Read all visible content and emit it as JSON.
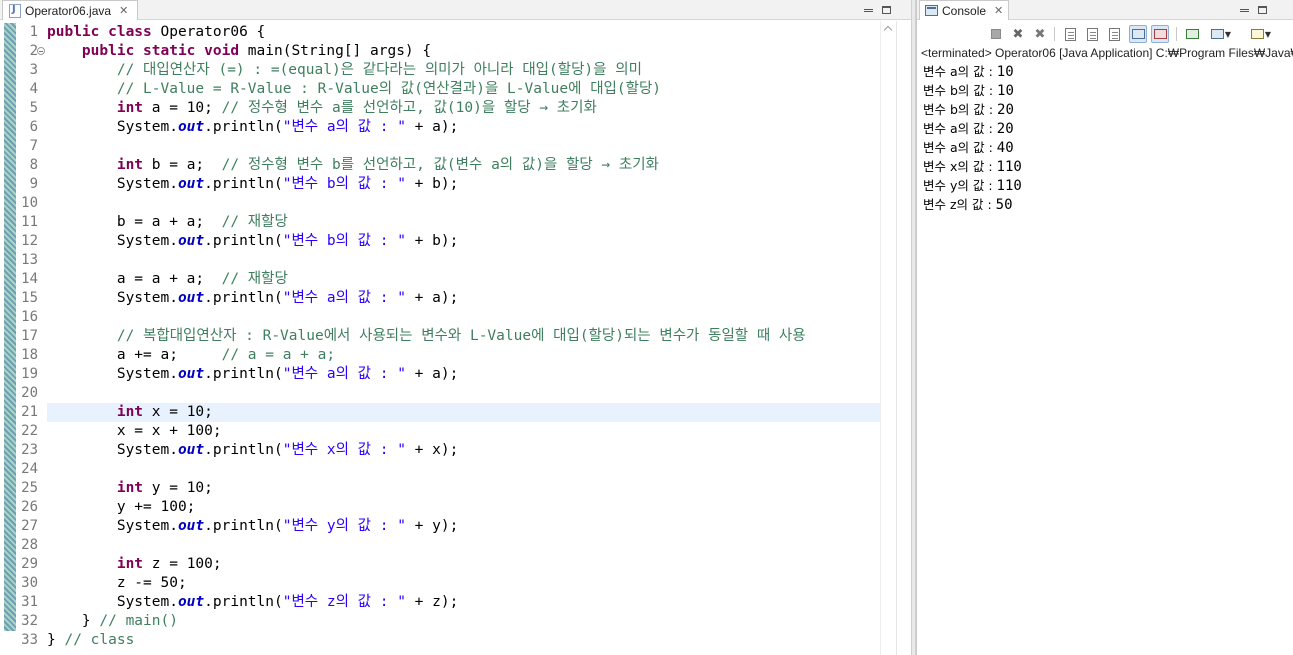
{
  "editor": {
    "tab_title": "Operator06.java",
    "tab_close": "✕",
    "current_line": 21,
    "lines": [
      {
        "n": "1",
        "fold": false,
        "segs": [
          [
            "kw",
            "public class "
          ],
          [
            "",
            "Operator06 {"
          ]
        ]
      },
      {
        "n": "2",
        "fold": true,
        "segs": [
          [
            "",
            "    "
          ],
          [
            "kw",
            "public static void "
          ],
          [
            "",
            "main(String[] args) {"
          ]
        ]
      },
      {
        "n": "3",
        "fold": false,
        "segs": [
          [
            "",
            "        "
          ],
          [
            "cm",
            "// 대입연산자 (=) : =(equal)은 같다라는 의미가 아니라 대입(할당)을 의미"
          ]
        ]
      },
      {
        "n": "4",
        "fold": false,
        "segs": [
          [
            "",
            "        "
          ],
          [
            "cm",
            "// L-Value = R-Value : R-Value의 값(연산결과)을 L-Value에 대입(할당)"
          ]
        ]
      },
      {
        "n": "5",
        "fold": false,
        "segs": [
          [
            "",
            "        "
          ],
          [
            "kw",
            "int"
          ],
          [
            "",
            " a = 10; "
          ],
          [
            "cm",
            "// 정수형 변수 a를 선언하고, 값(10)을 할당 → 초기화"
          ]
        ]
      },
      {
        "n": "6",
        "fold": false,
        "segs": [
          [
            "",
            "        System."
          ],
          [
            "fld",
            "out"
          ],
          [
            "",
            ".println("
          ],
          [
            "st",
            "\"변수 a의 값 : \""
          ],
          [
            "",
            " + a);"
          ]
        ]
      },
      {
        "n": "7",
        "fold": false,
        "segs": []
      },
      {
        "n": "8",
        "fold": false,
        "segs": [
          [
            "",
            "        "
          ],
          [
            "kw",
            "int"
          ],
          [
            "",
            " b = a;  "
          ],
          [
            "cm",
            "// 정수형 변수 b를 선언하고, 값(변수 a의 값)을 할당 → 초기화"
          ]
        ]
      },
      {
        "n": "9",
        "fold": false,
        "segs": [
          [
            "",
            "        System."
          ],
          [
            "fld",
            "out"
          ],
          [
            "",
            ".println("
          ],
          [
            "st",
            "\"변수 b의 값 : \""
          ],
          [
            "",
            " + b);"
          ]
        ]
      },
      {
        "n": "10",
        "fold": false,
        "segs": []
      },
      {
        "n": "11",
        "fold": false,
        "segs": [
          [
            "",
            "        b = a + a;  "
          ],
          [
            "cm",
            "// 재할당"
          ]
        ]
      },
      {
        "n": "12",
        "fold": false,
        "segs": [
          [
            "",
            "        System."
          ],
          [
            "fld",
            "out"
          ],
          [
            "",
            ".println("
          ],
          [
            "st",
            "\"변수 b의 값 : \""
          ],
          [
            "",
            " + b);"
          ]
        ]
      },
      {
        "n": "13",
        "fold": false,
        "segs": []
      },
      {
        "n": "14",
        "fold": false,
        "segs": [
          [
            "",
            "        a = a + a;  "
          ],
          [
            "cm",
            "// 재할당"
          ]
        ]
      },
      {
        "n": "15",
        "fold": false,
        "segs": [
          [
            "",
            "        System."
          ],
          [
            "fld",
            "out"
          ],
          [
            "",
            ".println("
          ],
          [
            "st",
            "\"변수 a의 값 : \""
          ],
          [
            "",
            " + a);"
          ]
        ]
      },
      {
        "n": "16",
        "fold": false,
        "segs": []
      },
      {
        "n": "17",
        "fold": false,
        "segs": [
          [
            "",
            "        "
          ],
          [
            "cm",
            "// 복합대입연산자 : R-Value에서 사용되는 변수와 L-Value에 대입(할당)되는 변수가 동일할 때 사용"
          ]
        ]
      },
      {
        "n": "18",
        "fold": false,
        "segs": [
          [
            "",
            "        a += a;     "
          ],
          [
            "cm",
            "// a = a + a;"
          ]
        ]
      },
      {
        "n": "19",
        "fold": false,
        "segs": [
          [
            "",
            "        System."
          ],
          [
            "fld",
            "out"
          ],
          [
            "",
            ".println("
          ],
          [
            "st",
            "\"변수 a의 값 : \""
          ],
          [
            "",
            " + a);"
          ]
        ]
      },
      {
        "n": "20",
        "fold": false,
        "segs": []
      },
      {
        "n": "21",
        "fold": false,
        "segs": [
          [
            "",
            "        "
          ],
          [
            "kw",
            "int"
          ],
          [
            "",
            " x = 10;"
          ]
        ]
      },
      {
        "n": "22",
        "fold": false,
        "segs": [
          [
            "",
            "        x = x + 100;"
          ]
        ]
      },
      {
        "n": "23",
        "fold": false,
        "segs": [
          [
            "",
            "        System."
          ],
          [
            "fld",
            "out"
          ],
          [
            "",
            ".println("
          ],
          [
            "st",
            "\"변수 x의 값 : \""
          ],
          [
            "",
            " + x);"
          ]
        ]
      },
      {
        "n": "24",
        "fold": false,
        "segs": []
      },
      {
        "n": "25",
        "fold": false,
        "segs": [
          [
            "",
            "        "
          ],
          [
            "kw",
            "int"
          ],
          [
            "",
            " y = 10;"
          ]
        ]
      },
      {
        "n": "26",
        "fold": false,
        "segs": [
          [
            "",
            "        y += 100;"
          ]
        ]
      },
      {
        "n": "27",
        "fold": false,
        "segs": [
          [
            "",
            "        System."
          ],
          [
            "fld",
            "out"
          ],
          [
            "",
            ".println("
          ],
          [
            "st",
            "\"변수 y의 값 : \""
          ],
          [
            "",
            " + y);"
          ]
        ]
      },
      {
        "n": "28",
        "fold": false,
        "segs": []
      },
      {
        "n": "29",
        "fold": false,
        "segs": [
          [
            "",
            "        "
          ],
          [
            "kw",
            "int"
          ],
          [
            "",
            " z = 100;"
          ]
        ]
      },
      {
        "n": "30",
        "fold": false,
        "segs": [
          [
            "",
            "        z -= 50;"
          ]
        ]
      },
      {
        "n": "31",
        "fold": false,
        "segs": [
          [
            "",
            "        System."
          ],
          [
            "fld",
            "out"
          ],
          [
            "",
            ".println("
          ],
          [
            "st",
            "\"변수 z의 값 : \""
          ],
          [
            "",
            " + z);"
          ]
        ]
      },
      {
        "n": "32",
        "fold": false,
        "segs": [
          [
            "",
            "    } "
          ],
          [
            "cm",
            "// main()"
          ]
        ]
      },
      {
        "n": "33",
        "fold": false,
        "segs": [
          [
            "",
            "} "
          ],
          [
            "cm",
            "// class"
          ]
        ]
      }
    ]
  },
  "console": {
    "tab_title": "Console",
    "tab_close": "✕",
    "header": "<terminated> Operator06 [Java Application] C:₩Program Files₩Java₩",
    "output": [
      {
        "label": "변수 a의 값 : ",
        "value": "10"
      },
      {
        "label": "변수 b의 값 : ",
        "value": "10"
      },
      {
        "label": "변수 b의 값 : ",
        "value": "20"
      },
      {
        "label": "변수 a의 값 : ",
        "value": "20"
      },
      {
        "label": "변수 a의 값 : ",
        "value": "40"
      },
      {
        "label": "변수 x의 값 : ",
        "value": "110"
      },
      {
        "label": "변수 y의 값 : ",
        "value": "110"
      },
      {
        "label": "변수 z의 값 : ",
        "value": "50"
      }
    ]
  },
  "colors": {
    "keyword": "#7f0055",
    "comment": "#3f7f5f",
    "string": "#2a00ff",
    "field": "#0000c0",
    "current_line_bg": "#e8f2fe"
  },
  "icons": {
    "editor_tab": "java-file-icon",
    "console_tab": "console-icon",
    "toolbar": [
      "terminate-icon",
      "remove-launch-icon",
      "remove-all-terminated-icon",
      "clear-console-icon",
      "scroll-lock-icon",
      "word-wrap-icon",
      "show-console-on-stdout-icon",
      "show-console-on-stderr-icon",
      "pin-console-icon",
      "display-selected-console-icon",
      "open-console-icon"
    ]
  }
}
